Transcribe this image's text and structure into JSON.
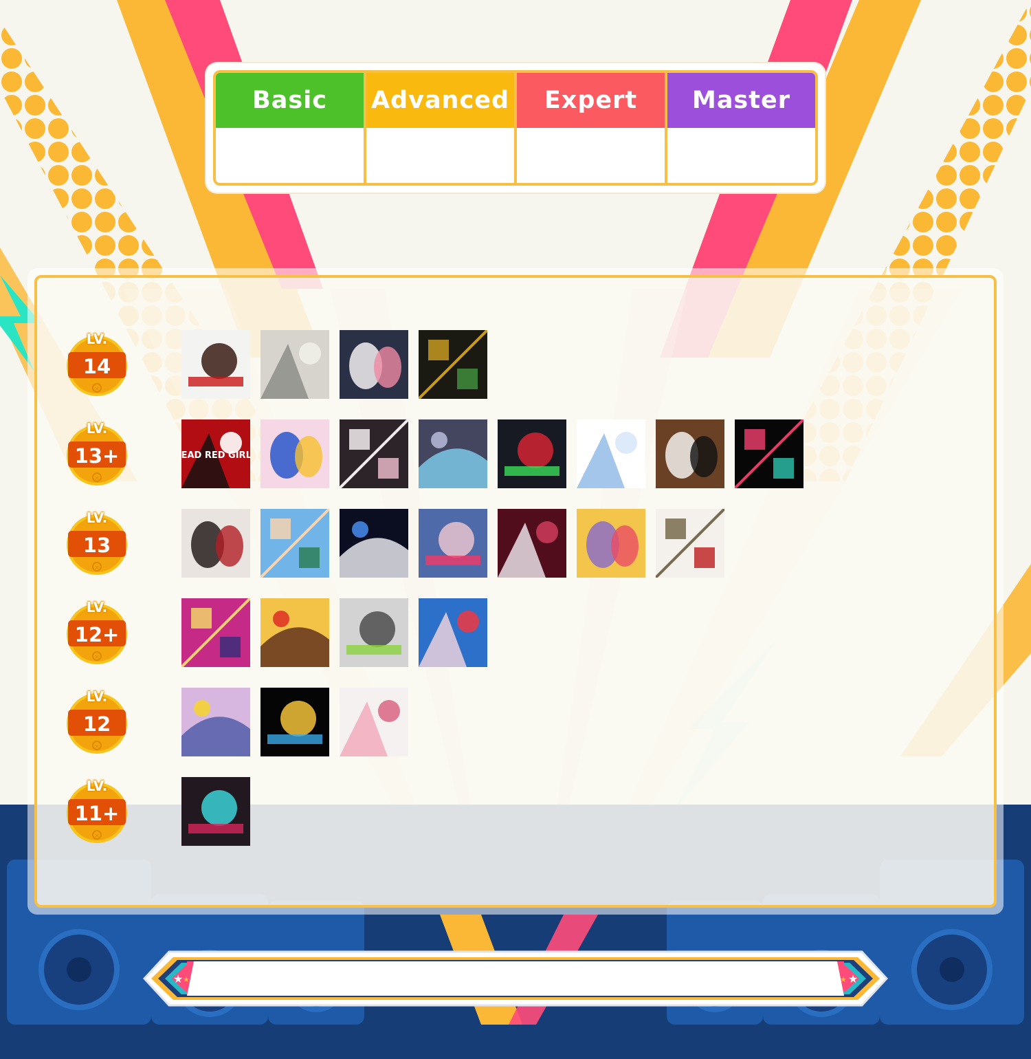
{
  "difficulty_tabs": [
    {
      "label": "Basic",
      "color": "#4cc12a"
    },
    {
      "label": "Advanced",
      "color": "#f9b90f"
    },
    {
      "label": "Expert",
      "color": "#fb5a61"
    },
    {
      "label": "Master",
      "color": "#9b4fdb"
    }
  ],
  "levels": [
    {
      "prefix": "LV.",
      "value": "14",
      "jackets": [
        {
          "name": "jacket-14-1",
          "bg": "#f3f3f1",
          "fg": "#3a1c14",
          "accent": "#c81818"
        },
        {
          "name": "jacket-14-2",
          "bg": "#d6d4cc",
          "fg": "#8a8a84",
          "accent": "#f0efe9"
        },
        {
          "name": "jacket-14-3",
          "bg": "#2a3046",
          "fg": "#f2eff0",
          "accent": "#ef8aa3"
        },
        {
          "name": "jacket-14-4",
          "bg": "#1b1a12",
          "fg": "#c49a22",
          "accent": "#3f8e3c"
        }
      ]
    },
    {
      "prefix": "LV.",
      "value": "13+",
      "jackets": [
        {
          "name": "jacket-13p-1",
          "bg": "#b10d12",
          "fg": "#111111",
          "accent": "#ffffff",
          "text": "DEAD RED GIRLS"
        },
        {
          "name": "jacket-13p-2",
          "bg": "#f6d7e6",
          "fg": "#2a57c9",
          "accent": "#f7c12f"
        },
        {
          "name": "jacket-13p-3",
          "bg": "#2c2429",
          "fg": "#f4eef0",
          "accent": "#e8b7c8"
        },
        {
          "name": "jacket-13p-4",
          "bg": "#44465f",
          "fg": "#7fd0ef",
          "accent": "#a6a9c8"
        },
        {
          "name": "jacket-13p-5",
          "bg": "#171a22",
          "fg": "#d32534",
          "accent": "#3adc58"
        },
        {
          "name": "jacket-13p-6",
          "bg": "#ffffff",
          "fg": "#8fb8e6",
          "accent": "#d8e8f8"
        },
        {
          "name": "jacket-13p-7",
          "bg": "#6b4125",
          "fg": "#f1f0ec",
          "accent": "#111111"
        },
        {
          "name": "jacket-13p-8",
          "bg": "#070707",
          "fg": "#e43b69",
          "accent": "#2bb9a6"
        }
      ]
    },
    {
      "prefix": "LV.",
      "value": "13",
      "jackets": [
        {
          "name": "jacket-13-1",
          "bg": "#e9e4e0",
          "fg": "#28201e",
          "accent": "#b31f26"
        },
        {
          "name": "jacket-13-2",
          "bg": "#71b4e8",
          "fg": "#f6d3b2",
          "accent": "#2c7f57"
        },
        {
          "name": "jacket-13-3",
          "bg": "#0b0d20",
          "fg": "#f2f2f7",
          "accent": "#3e79d0"
        },
        {
          "name": "jacket-13-4",
          "bg": "#4f6aa8",
          "fg": "#e7c2cf",
          "accent": "#f23a66"
        },
        {
          "name": "jacket-13-5",
          "bg": "#520d1d",
          "fg": "#f1ecf2",
          "accent": "#c73a5a"
        },
        {
          "name": "jacket-13-6",
          "bg": "#f3c54b",
          "fg": "#8d6fc5",
          "accent": "#ea4c64"
        },
        {
          "name": "jacket-13-7",
          "bg": "#f4f1ec",
          "fg": "#786b4e",
          "accent": "#bf2a2a"
        }
      ]
    },
    {
      "prefix": "LV.",
      "value": "12+",
      "jackets": [
        {
          "name": "jacket-12p-1",
          "bg": "#c52a86",
          "fg": "#f0d46b",
          "accent": "#3b2d7b"
        },
        {
          "name": "jacket-12p-2",
          "bg": "#f3c347",
          "fg": "#5a2c1c",
          "accent": "#e2442a"
        },
        {
          "name": "jacket-12p-3",
          "bg": "#d3d3d3",
          "fg": "#4d4d4d",
          "accent": "#8cd33d"
        },
        {
          "name": "jacket-12p-4",
          "bg": "#2d70c9",
          "fg": "#f5d7df",
          "accent": "#e33b48"
        }
      ]
    },
    {
      "prefix": "LV.",
      "value": "12",
      "jackets": [
        {
          "name": "jacket-12-1",
          "bg": "#d7b7e0",
          "fg": "#4b57a5",
          "accent": "#f2d046"
        },
        {
          "name": "jacket-12-2",
          "bg": "#050505",
          "fg": "#f2c23a",
          "accent": "#38a7e5"
        },
        {
          "name": "jacket-12-3",
          "bg": "#f6f1f1",
          "fg": "#f3a8ba",
          "accent": "#dc6d88"
        }
      ]
    },
    {
      "prefix": "LV.",
      "value": "11+",
      "jackets": [
        {
          "name": "jacket-11p-1",
          "bg": "#21191f",
          "fg": "#39d2d6",
          "accent": "#d6245a"
        }
      ]
    }
  ],
  "bottom_bar": {
    "text": ""
  }
}
